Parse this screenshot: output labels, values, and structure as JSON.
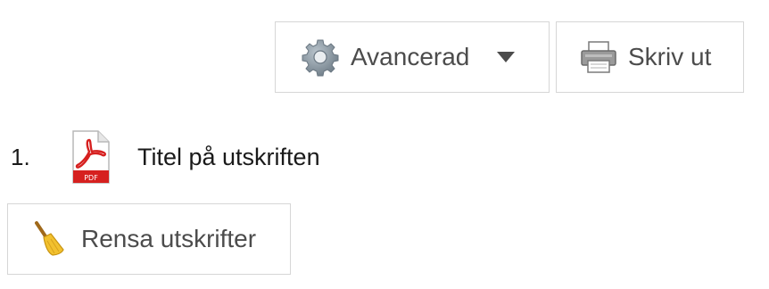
{
  "toolbar": {
    "advanced_label": "Avancerad",
    "print_label": "Skriv ut"
  },
  "results": {
    "items": [
      {
        "index": "1.",
        "title": "Titel på utskriften",
        "icon": "pdf-icon"
      }
    ]
  },
  "clear_button": {
    "label": "Rensa utskrifter"
  },
  "icons": {
    "advanced": "gear-icon",
    "advanced_menu": "chevron-down-icon",
    "print": "printer-icon",
    "clear": "broom-icon"
  },
  "colors": {
    "pdf_red": "#d6201f",
    "border": "#d6d6d6",
    "text": "#4c4c4c"
  }
}
